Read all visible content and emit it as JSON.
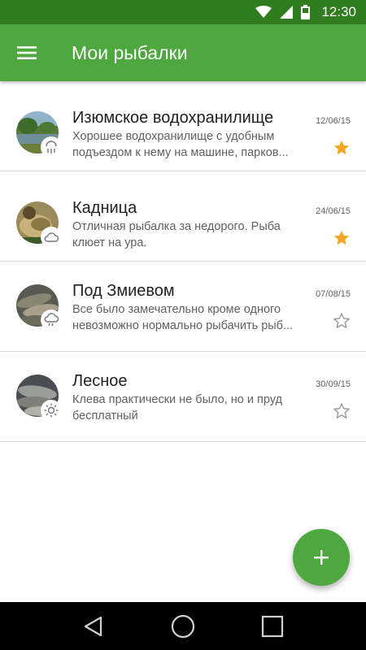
{
  "status_bar": {
    "time": "12:30",
    "icons": [
      "wifi-icon",
      "cell-signal-icon",
      "battery-icon"
    ]
  },
  "app_bar": {
    "title": "Мои рыбалки",
    "menu_icon": "hamburger-menu-icon"
  },
  "fishing_trips": [
    {
      "title": "Изюмское водохранилище",
      "description_lines": [
        "Хорошее водохранилище с удобным",
        "подъездом к нему  на машине, парков..."
      ],
      "date": "12/06/15",
      "favorite": true,
      "weather_icon": "rain-icon"
    },
    {
      "title": "Кадница",
      "description_lines": [
        "Отличная рыбалка за недорого. Рыба",
        "клюет на ура."
      ],
      "date": "24/06/15",
      "favorite": true,
      "weather_icon": "cloud-icon"
    },
    {
      "title": "Под Змиевом",
      "description_lines": [
        "Все было замечательно кроме одного",
        "невозможно нормально рыбачить рыб..."
      ],
      "date": "07/08/15",
      "favorite": false,
      "weather_icon": "cloud-rain-icon"
    },
    {
      "title": "Лесное",
      "description_lines": [
        "Клева практически не было, но и пруд",
        "бесплатный"
      ],
      "date": "30/09/15",
      "favorite": false,
      "weather_icon": "sun-icon"
    }
  ],
  "fab": {
    "icon": "plus-icon"
  },
  "nav_bar": {
    "icons": [
      "back-icon",
      "home-icon",
      "recents-icon"
    ]
  },
  "colors": {
    "status_bar": "#2f7d1f",
    "app_bar": "#4ea83f",
    "star_active": "#f5a623",
    "star_inactive": "#9e9e9e"
  }
}
